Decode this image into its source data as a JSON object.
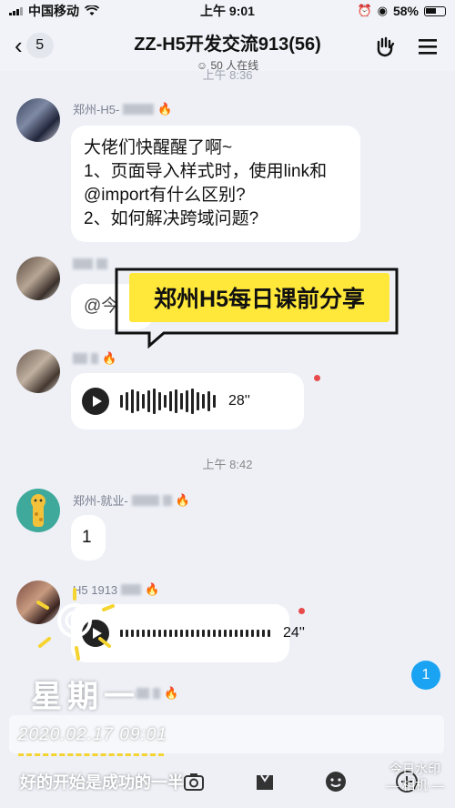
{
  "status_bar": {
    "carrier": "中国移动",
    "time": "上午 9:01",
    "battery": "58%"
  },
  "header": {
    "unread_count": "5",
    "title": "ZZ-H5开发交流913(56)",
    "online": "50 人在线"
  },
  "dividers": {
    "top": "上午 8:36",
    "mid": "上午 8:42"
  },
  "messages": [
    {
      "sender": "郑州-H5-",
      "text_lines": [
        "大佬们快醒醒了啊~",
        "1、页面导入样式时，使用link和",
        "@import有什么区别?",
        "2、如何解决跨域问题?"
      ]
    },
    {
      "sender": "",
      "partial_text": "@今"
    },
    {
      "sender": "",
      "voice_duration": "28''"
    },
    {
      "sender": "郑州-就业-",
      "text": "1"
    },
    {
      "sender": "H5 1913",
      "voice_duration": "24''"
    }
  ],
  "banner": {
    "text": "郑州H5每日课前分享"
  },
  "scroll_badge": "1",
  "watermark": {
    "weekday": "星期一",
    "datetime": "2020.02.17 09:01",
    "slogan": "好的开始是成功的一半",
    "app_name": "今日水印",
    "app_sub": "— 相机 —"
  },
  "icons": [
    "wifi-icon",
    "alarm-icon",
    "location-icon",
    "group-hand-icon",
    "menu-icon",
    "image-icon",
    "camera-icon",
    "gift-icon",
    "emoji-icon",
    "plus-icon"
  ]
}
